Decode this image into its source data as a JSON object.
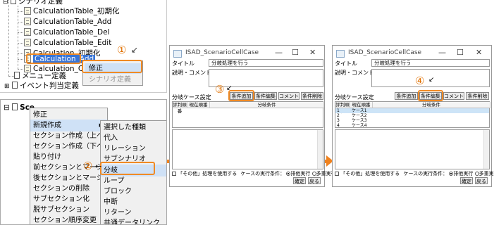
{
  "panel1": {
    "tree": [
      "シナリオ定義",
      "CalculationTable_初期化",
      "CalculationTable_Add",
      "CalculationTable_Del",
      "CalculationTable_Edit",
      "Calculation_初期化",
      "Calculation_Add",
      "Calculation_Cl",
      "メニュー定義",
      "イベント判当定義"
    ],
    "context_menu": {
      "item1": "修正",
      "item2": "シナリオ定義"
    },
    "callout": "①"
  },
  "panel2": {
    "tree_root": "Sce",
    "menu_main": [
      "修正",
      "新規作成",
      "セクション作成（上へ）",
      "セクション作成（下へ）",
      "貼り付け",
      "前セクションとマージ",
      "後セクションとマージ",
      "セクションの削除",
      "サブセクション化",
      "脱サブセクション",
      "セクション順序変更"
    ],
    "submenu_arrow": "▶",
    "submenu": [
      "選択した種類",
      "代入",
      "リレーション",
      "サブシナリオ",
      "分岐",
      "ループ",
      "ブロック",
      "中断",
      "リターン",
      "共通データリンク"
    ],
    "callout": "②"
  },
  "dialog": {
    "title": "ISAD_ScenarioCellCase",
    "minimize": "—",
    "maximize": "☐",
    "close": "✕",
    "title_label": "タイトル",
    "title_value": "分岐処理を行う",
    "desc_label": "説明・コメント：",
    "case_label": "分岐ケース設定",
    "btn_add": "条件追加",
    "btn_edit": "条件編集",
    "btn_comment": "コメント",
    "btn_delete": "条件削除",
    "col_eval": "評判順番",
    "col_exec": "現在順番",
    "col_cond": "分岐条件",
    "other_label": "「その他」処理を使用する",
    "exec_label": "ケースの実行条件：",
    "radio1": "排他実行",
    "radio2": "多重実行",
    "btn_ok": "確定",
    "btn_back": "戻る"
  },
  "dialog2_rows": [
    {
      "num": "1",
      "name": "ケース1"
    },
    {
      "num": "2",
      "name": "ケース2"
    },
    {
      "num": "3",
      "name": "ケース3"
    },
    {
      "num": "4",
      "name": "ケース4"
    }
  ],
  "callout3": "③",
  "callout4": "④",
  "colors": {
    "accent_orange": "#f0821e",
    "selection_blue": "#3875d7",
    "row_highlight": "#cde4f7"
  }
}
